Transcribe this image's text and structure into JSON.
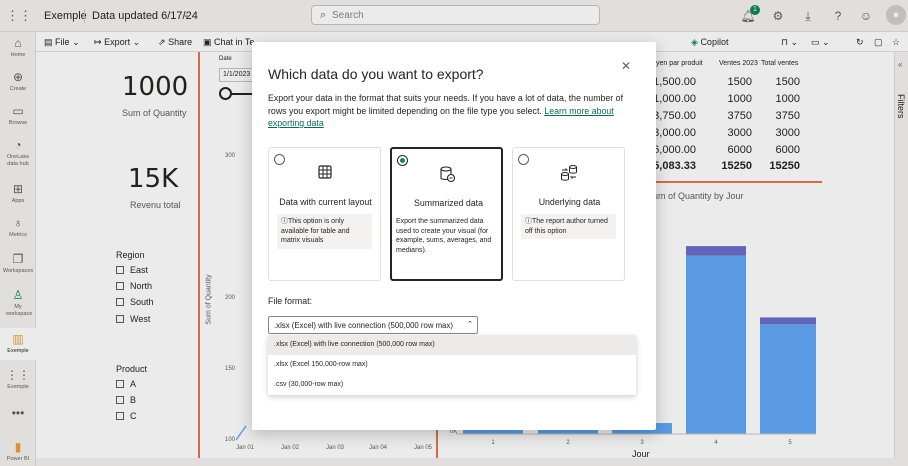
{
  "topbar": {
    "workspace": "Exemple",
    "updated": "Data updated 6/17/24",
    "search_placeholder": "Search",
    "notification_count": "1"
  },
  "leftnav": {
    "items": [
      {
        "label": "Home",
        "icon": "home-icon",
        "glyph": "⌂"
      },
      {
        "label": "Create",
        "icon": "plus-circle-icon",
        "glyph": "⊕"
      },
      {
        "label": "Browse",
        "icon": "folder-icon",
        "glyph": "▭"
      },
      {
        "label": "OneLake data hub",
        "icon": "onelake-icon",
        "glyph": "◔"
      },
      {
        "label": "Apps",
        "icon": "apps-icon",
        "glyph": "⊞"
      },
      {
        "label": "Metrics",
        "icon": "trophy-icon",
        "glyph": "♁"
      },
      {
        "label": "Workspaces",
        "icon": "workspaces-icon",
        "glyph": "❐"
      },
      {
        "label": "My workspace",
        "icon": "person-icon",
        "glyph": "♙"
      },
      {
        "label": "Exemple",
        "icon": "report-icon",
        "glyph": "▥"
      },
      {
        "label": "Exemple",
        "icon": "dataset-icon",
        "glyph": "⋮⋮"
      },
      {
        "label": "",
        "icon": "more-icon",
        "glyph": "•••"
      }
    ],
    "powerbi_label": "Power BI"
  },
  "ribbon": {
    "file": "File",
    "export": "Export",
    "share": "Share",
    "chat": "Chat in Te",
    "copilot": "Copilot"
  },
  "canvas": {
    "kpi1_value": "1000",
    "kpi1_label": "Sum of Quantity",
    "kpi2_value": "15K",
    "kpi2_label": "Revenu total",
    "region_title": "Region",
    "regions": [
      "East",
      "North",
      "South",
      "West"
    ],
    "product_title": "Product",
    "products": [
      "A",
      "B",
      "C"
    ],
    "date_label": "Date",
    "date_value": "1/1/2023",
    "line_ylabel": "Sum of Quantity",
    "line_yticks": [
      "300",
      "200",
      "150",
      "100"
    ],
    "line_xticks": [
      "Jan 01",
      "Jan 02",
      "Jan 03",
      "Jan 04",
      "Jan 05"
    ],
    "table_headers": [
      "yen par produit",
      "Ventes 2023",
      "Total ventes"
    ],
    "table_rows": [
      [
        "1,500.00",
        "1500",
        "1500"
      ],
      [
        "1,000.00",
        "1000",
        "1000"
      ],
      [
        "3,750.00",
        "3750",
        "3750"
      ],
      [
        "3,000.00",
        "3000",
        "3000"
      ],
      [
        "6,000.00",
        "6000",
        "6000"
      ]
    ],
    "table_total": [
      "5,083.33",
      "15250",
      "15250"
    ],
    "bar_title": "um of Quantity by Jour",
    "bar_xlabel": "Jour",
    "bar_ytick": "0K",
    "bar_xticks": [
      "1",
      "2",
      "3",
      "4",
      "5"
    ]
  },
  "chart_data": {
    "type": "bar",
    "title": "um of Quantity by Jour",
    "xlabel": "Jour",
    "ylabel": "",
    "categories": [
      "1",
      "2",
      "3",
      "4",
      "5"
    ],
    "series": [
      {
        "values": [
          60,
          60,
          80,
          1300,
          800
        ]
      },
      {
        "values": [
          0,
          0,
          0,
          70,
          50
        ]
      }
    ],
    "ylim": [
      0,
      1400
    ],
    "colors": [
      "#62a8f7",
      "#6b6fc9"
    ]
  },
  "filters": {
    "label": "Filters"
  },
  "dialog": {
    "title": "Which data do you want to export?",
    "description": "Export your data in the format that suits your needs. If you have a lot of data, the number of rows you export might be limited depending on the file type you select.",
    "link": "Learn more about exporting data",
    "options": [
      {
        "title": "Data with current layout",
        "note": "This option is only available for table and matrix visuals",
        "icon": "table-icon"
      },
      {
        "title": "Summarized data",
        "desc": "Export the summarized data used to create your visual (for example, sums, averages, and medians).",
        "icon": "database-icon"
      },
      {
        "title": "Underlying data",
        "note": "The report author turned off this option",
        "icon": "data-transform-icon"
      }
    ],
    "file_format_label": "File format:",
    "file_format_value": ".xlsx (Excel) with live connection (500,000 row max)",
    "file_format_options": [
      ".xlsx (Excel) with live connection (500,000 row max)",
      ".xlsx (Excel 150,000-row max)",
      ".csv (30,000-row max)"
    ]
  },
  "status": {
    "zoom": "90%"
  }
}
